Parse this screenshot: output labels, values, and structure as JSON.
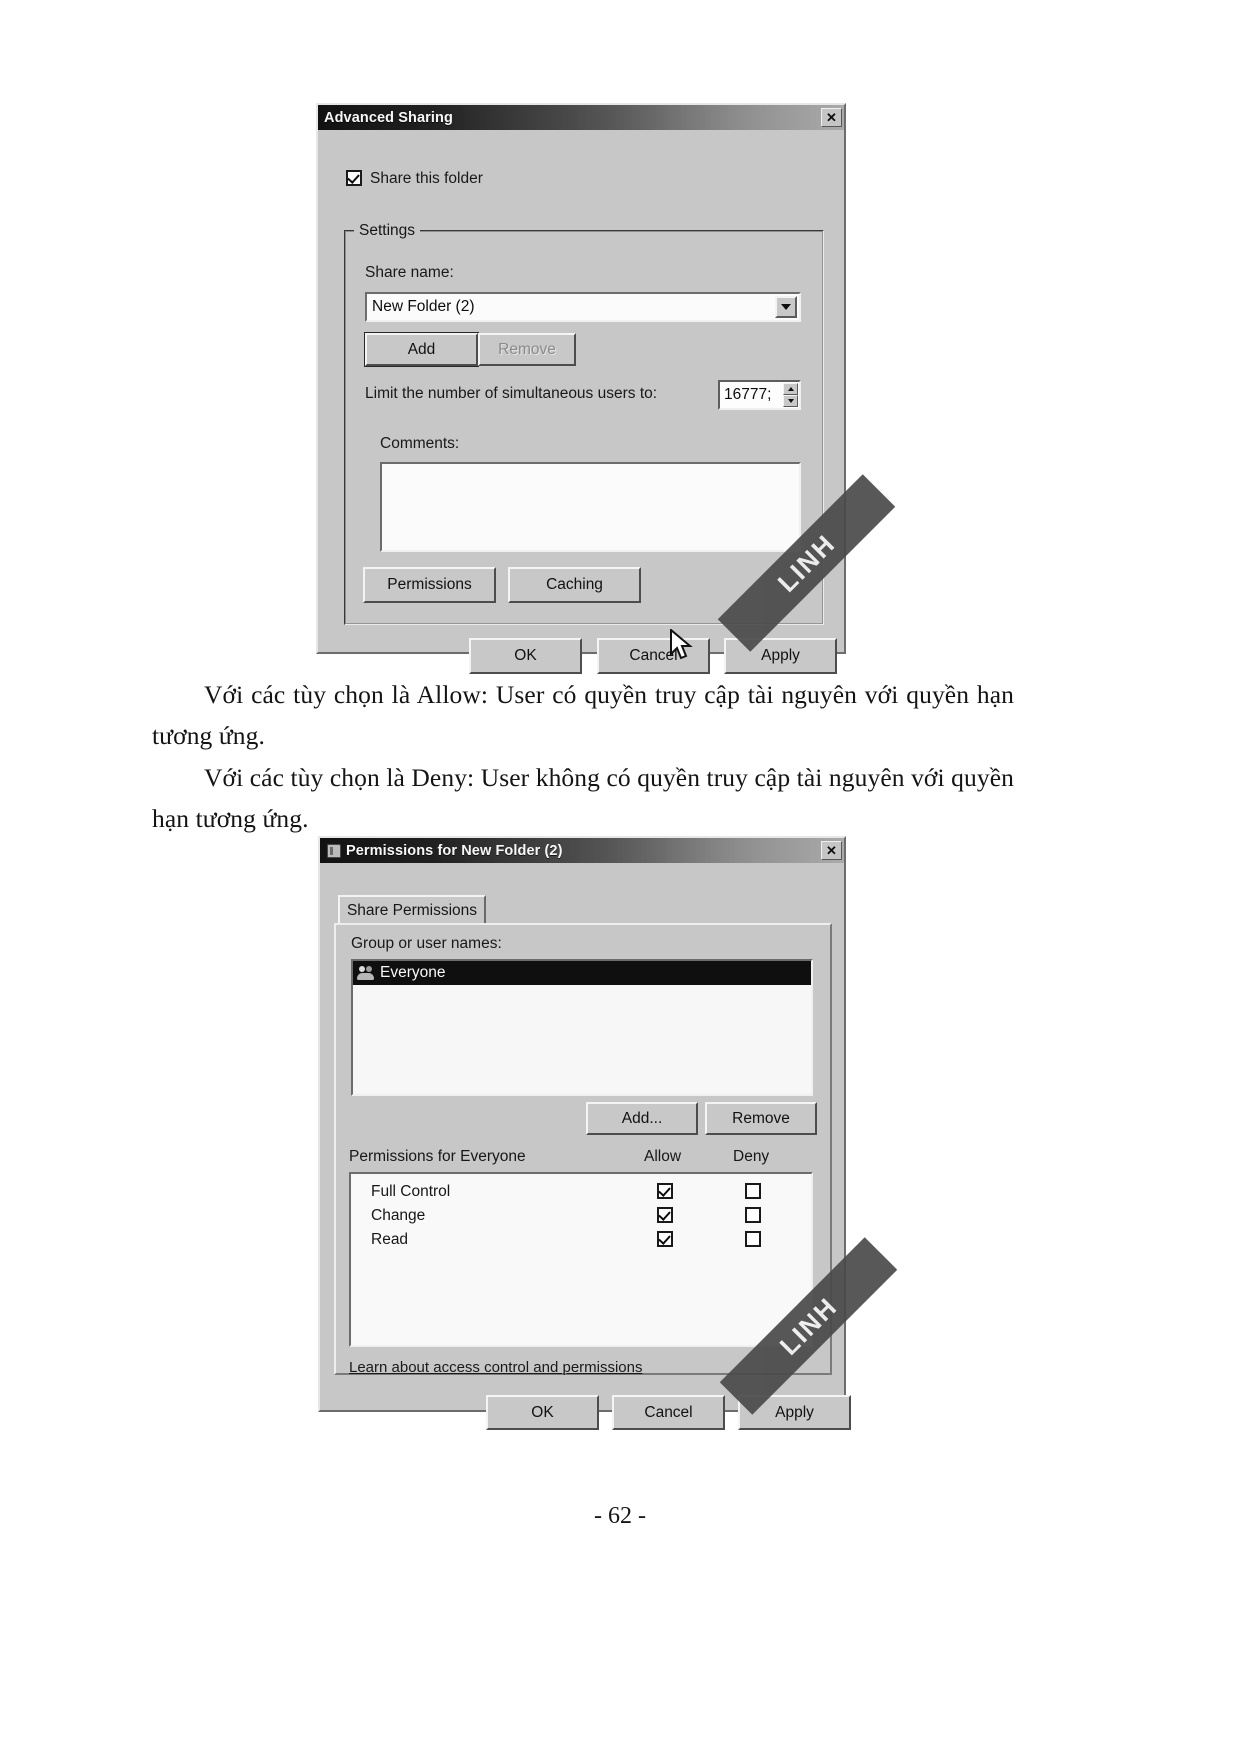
{
  "page": {
    "folio": "- 62 -",
    "paragraphs": [
      "Với các tùy chọn là Allow: User có quyền truy cập tài nguyên với quyền hạn tương ứng.",
      "Với các tùy chọn là Deny: User không có quyền truy cập tài nguyên với quyền hạn tương ứng."
    ],
    "watermark": "LINH"
  },
  "advanced_sharing": {
    "title": "Advanced Sharing",
    "close_label": "✕",
    "share_this_folder": {
      "label": "Share this folder",
      "checked": true
    },
    "settings_group": "Settings",
    "share_name_label": "Share name:",
    "share_name_value": "New Folder (2)",
    "add_button": "Add",
    "remove_button": "Remove",
    "limit_label": "Limit the number of simultaneous users to:",
    "limit_value": "16777;",
    "comments_label": "Comments:",
    "comments_value": "",
    "permissions_button": "Permissions",
    "caching_button": "Caching",
    "ok_button": "OK",
    "cancel_button": "Cancel",
    "apply_button": "Apply"
  },
  "permissions_dialog": {
    "title": "Permissions for New Folder (2)",
    "close_label": "✕",
    "tab_share_permissions": "Share Permissions",
    "group_or_user_names_label": "Group or user names:",
    "users": [
      {
        "name": "Everyone",
        "selected": true
      }
    ],
    "add_button": "Add...",
    "remove_button": "Remove",
    "permissions_for_label": "Permissions for Everyone",
    "col_allow": "Allow",
    "col_deny": "Deny",
    "rows": [
      {
        "name": "Full Control",
        "allow": true,
        "deny": false
      },
      {
        "name": "Change",
        "allow": true,
        "deny": false
      },
      {
        "name": "Read",
        "allow": true,
        "deny": false
      }
    ],
    "learn_link": "Learn about access control and permissions",
    "ok_button": "OK",
    "cancel_button": "Cancel",
    "apply_button": "Apply"
  }
}
